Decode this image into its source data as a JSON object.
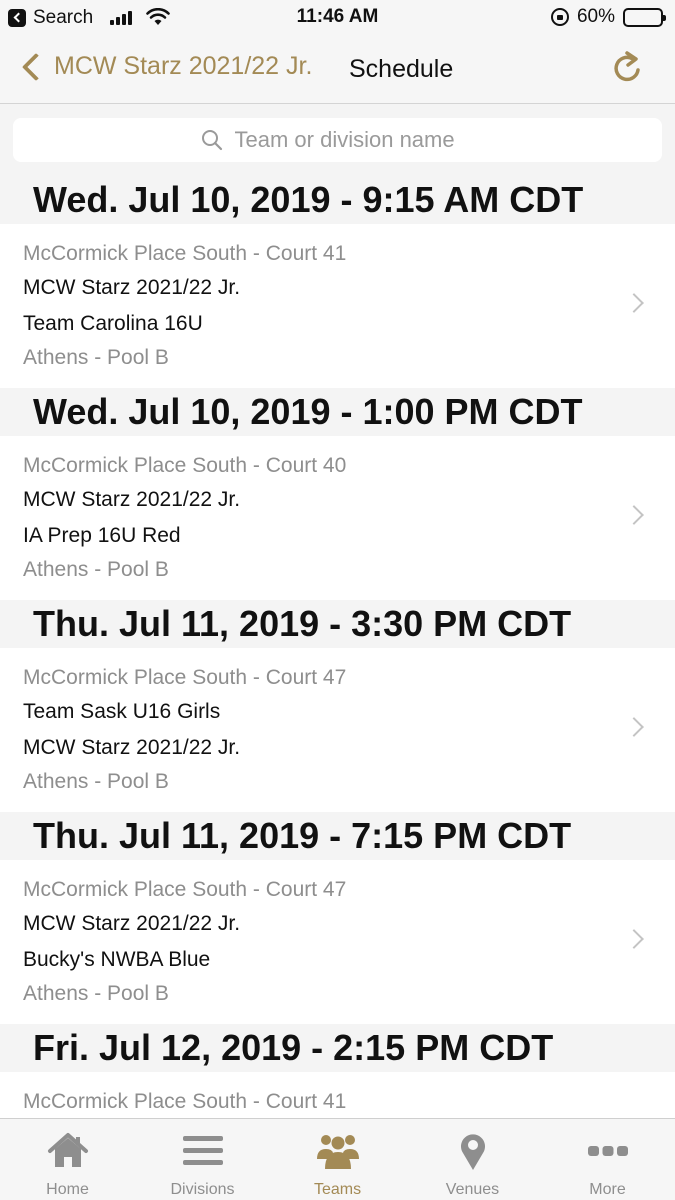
{
  "status_bar": {
    "back_app": "Search",
    "time": "11:46 AM",
    "battery_text": "60%",
    "battery_level": 0.6
  },
  "nav": {
    "back_label": "MCW Starz 2021/22 Jr.",
    "title": "Schedule"
  },
  "search": {
    "placeholder": "Team or division name"
  },
  "schedule": [
    {
      "date": "Wed. Jul 10, 2019 - 9:15 AM CDT",
      "venue": "McCormick Place South - Court 41",
      "team1": "MCW Starz 2021/22 Jr.",
      "team2": "Team Carolina 16U",
      "division": "Athens - Pool B"
    },
    {
      "date": "Wed. Jul 10, 2019 - 1:00 PM CDT",
      "venue": "McCormick Place South - Court 40",
      "team1": "MCW Starz 2021/22 Jr.",
      "team2": "IA Prep 16U Red",
      "division": "Athens - Pool B"
    },
    {
      "date": "Thu. Jul 11, 2019 - 3:30 PM CDT",
      "venue": "McCormick Place South - Court 47",
      "team1": "Team Sask U16 Girls",
      "team2": "MCW Starz 2021/22 Jr.",
      "division": "Athens - Pool B"
    },
    {
      "date": "Thu. Jul 11, 2019 - 7:15 PM CDT",
      "venue": "McCormick Place South - Court 47",
      "team1": "MCW Starz 2021/22 Jr.",
      "team2": "Bucky's NWBA Blue",
      "division": "Athens - Pool B"
    },
    {
      "date": "Fri. Jul 12, 2019 - 2:15 PM CDT",
      "venue": "McCormick Place South - Court 41"
    }
  ],
  "tabs": [
    {
      "label": "Home",
      "icon": "home-icon"
    },
    {
      "label": "Divisions",
      "icon": "list-icon"
    },
    {
      "label": "Teams",
      "icon": "people-icon",
      "active": true
    },
    {
      "label": "Venues",
      "icon": "map-pin-icon"
    },
    {
      "label": "More",
      "icon": "more-icon"
    }
  ],
  "colors": {
    "accent": "#a38a55",
    "inactive": "#8e8e8e"
  }
}
